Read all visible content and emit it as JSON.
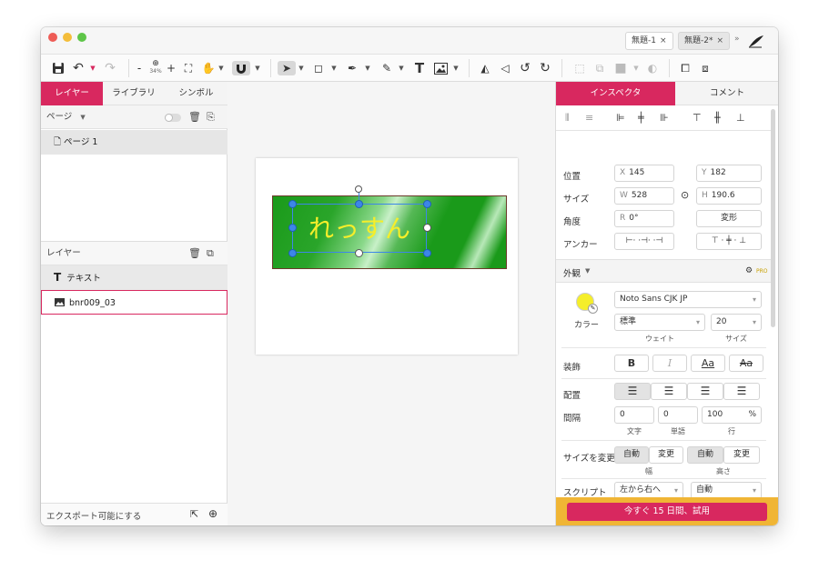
{
  "document_tabs": [
    {
      "label": "無題-1",
      "close": "×",
      "active": false
    },
    {
      "label": "無題-2*",
      "close": "×",
      "active": true
    }
  ],
  "toolbar": {
    "zoom_minus": "-",
    "zoom_level": "34%",
    "zoom_plus": "+"
  },
  "left_panel": {
    "tabs": [
      "レイヤー",
      "ライブラリ",
      "シンボル"
    ],
    "pages_header": "ページ",
    "pages": [
      "ページ 1"
    ],
    "layers_header": "レイヤー",
    "layers": [
      {
        "name": "テキスト",
        "icon": "text-icon"
      },
      {
        "name": "bnr009_03",
        "icon": "image-icon"
      }
    ],
    "footer_label": "エクスポート可能にする"
  },
  "canvas": {
    "banner_text": "れっすん",
    "text_color": "#f5ee2a",
    "banner_color": "#1a9a1a"
  },
  "inspector": {
    "tabs": [
      "インスペクタ",
      "コメント"
    ],
    "position_label": "位置",
    "x_prefix": "X",
    "x": "145",
    "y_prefix": "Y",
    "y": "182",
    "size_label": "サイズ",
    "w_prefix": "W",
    "w": "528",
    "h_prefix": "H",
    "h": "190.6",
    "angle_label": "角度",
    "r_prefix": "R",
    "r": "0°",
    "transform_button": "変形",
    "anchor_label": "アンカー",
    "appearance_label": "外観",
    "pro_badge": "PRO",
    "color_label": "カラー",
    "font_family": "Noto Sans CJK JP",
    "weight_value": "標準",
    "size_value": "20",
    "weight_sub": "ウェイト",
    "size_sub": "サイズ",
    "decoration_label": "装飾",
    "deco_bold": "B",
    "deco_italic": "I",
    "deco_underline": "Aa",
    "deco_strike": "Aa",
    "align_label": "配置",
    "spacing_label": "間隔",
    "char_spacing": "0",
    "word_spacing": "0",
    "line_spacing": "100",
    "percent": "%",
    "char_sub": "文字",
    "word_sub": "単語",
    "line_sub": "行",
    "resize_label": "サイズを変更",
    "auto1": "自動",
    "change1": "変更",
    "auto2": "自動",
    "change2": "変更",
    "width_sub": "幅",
    "height_sub": "高さ",
    "script_label": "スクリプト",
    "script_direction": "左から右へ",
    "script_auto": "自動",
    "trial_button": "今すぐ 15 日間、試用"
  },
  "colors": {
    "accent": "#d8285f",
    "trial_bar": "#f0b535",
    "handle": "#3d86e8"
  }
}
